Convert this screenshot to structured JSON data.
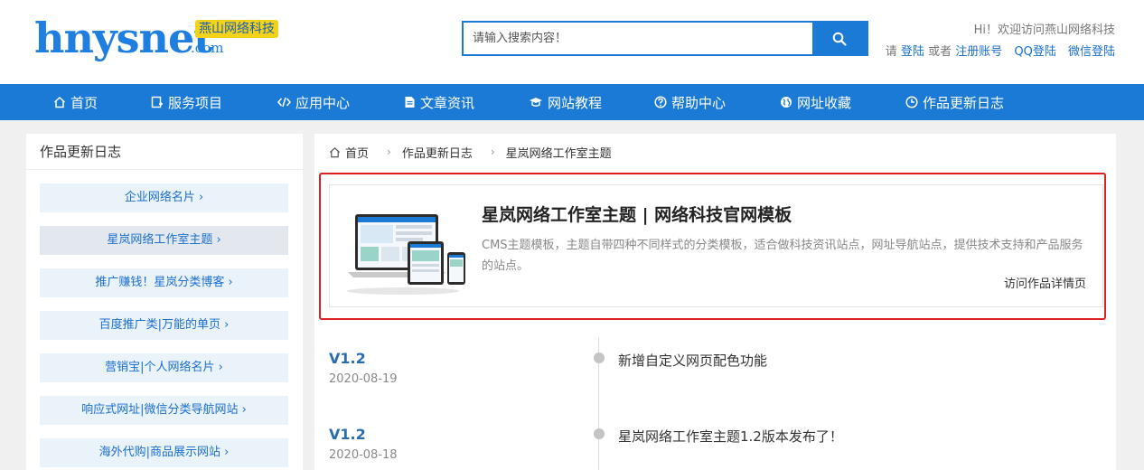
{
  "header": {
    "logo_text": "hnysnet",
    "logo_badge": "燕山网络科技",
    "logo_suffix": ".com",
    "search_placeholder": "请输入搜索内容！",
    "welcome": "Hi！欢迎访问燕山网络科技",
    "please": "请",
    "login": "登陆",
    "or": "或者",
    "register": "注册账号",
    "qq_login": "QQ登陆",
    "wechat_login": "微信登陆"
  },
  "nav": {
    "items": [
      {
        "label": "首页",
        "icon": "home-icon"
      },
      {
        "label": "服务项目",
        "icon": "service-icon"
      },
      {
        "label": "应用中心",
        "icon": "code-icon"
      },
      {
        "label": "文章资讯",
        "icon": "document-icon"
      },
      {
        "label": "网站教程",
        "icon": "graduation-cap-icon"
      },
      {
        "label": "帮助中心",
        "icon": "help-icon"
      },
      {
        "label": "网址收藏",
        "icon": "globe-icon"
      },
      {
        "label": "作品更新日志",
        "icon": "clock-icon"
      }
    ]
  },
  "sidebar": {
    "title": "作品更新日志",
    "items": [
      {
        "label": "企业网络名片 ›"
      },
      {
        "label": "星岚网络工作室主题 ›"
      },
      {
        "label": "推广赚钱！星岚分类博客 ›"
      },
      {
        "label": "百度推广类|万能的单页 ›"
      },
      {
        "label": "营销宝|个人网络名片 ›"
      },
      {
        "label": "响应式网址|微信分类导航网站 ›"
      },
      {
        "label": "海外代购|商品展示网站 ›"
      }
    ]
  },
  "breadcrumb": {
    "home": "首页",
    "level1": "作品更新日志",
    "level2": "星岚网络工作室主题",
    "separator": "›"
  },
  "work": {
    "title": "星岚网络工作室主题 | 网络科技官网模板",
    "description": "CMS主题模板，主题自带四种不同样式的分类模板，适合做科技资讯站点，网址导航站点，提供技术支持和产品服务的站点。",
    "link": "访问作品详情页"
  },
  "timeline": [
    {
      "version": "V1.2",
      "date": "2020-08-19",
      "text": "新增自定义网页配色功能"
    },
    {
      "version": "V1.2",
      "date": "2020-08-18",
      "text": "星岚网络工作室主题1.2版本发布了！"
    }
  ],
  "colors": {
    "primary": "#1b7ad6",
    "highlight_border": "#e02020",
    "logo_badge_bg": "#f5d21a"
  }
}
